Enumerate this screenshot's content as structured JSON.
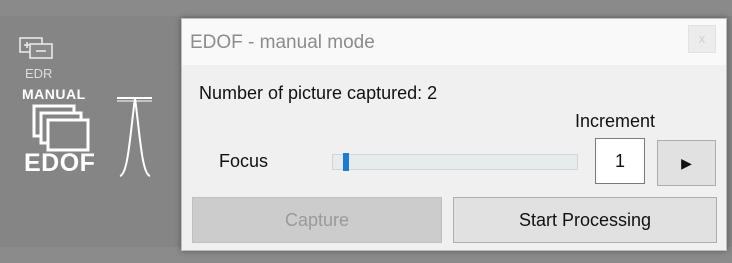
{
  "toolbar": {
    "edr_label": "EDR",
    "manual_label": "MANUAL",
    "edof_label": "EDOF",
    "edr_icon": "layered-screens-icon",
    "edof_icon": "stacked-frames-focus-curve-icon"
  },
  "dialog": {
    "title": "EDOF - manual mode",
    "close_label": "x",
    "captured_text": "Number of picture captured: 2",
    "increment_label": "Increment",
    "focus_label": "Focus",
    "focus_value": 0.04,
    "increment_value": "1",
    "play_glyph": "▶",
    "capture_label": "Capture",
    "start_processing_label": "Start Processing"
  },
  "colors": {
    "background": "#858585",
    "dialog_bg": "#f0f0f0",
    "slider_thumb": "#1a7ad4",
    "disabled_text": "#9a9a9a"
  }
}
